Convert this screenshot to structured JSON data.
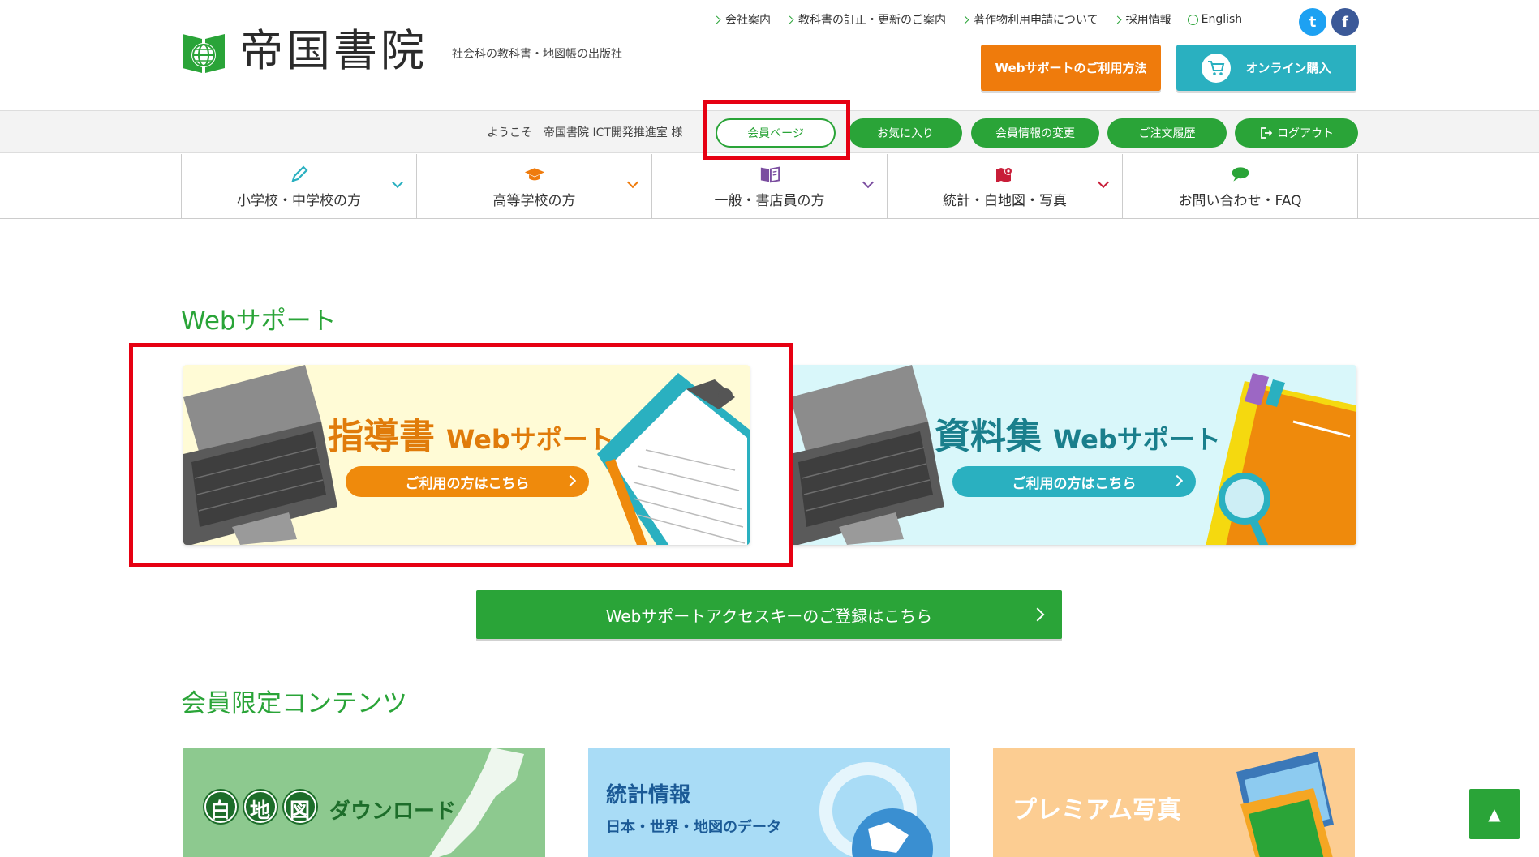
{
  "header": {
    "logo_text": "帝国書院",
    "tagline": "社会科の教科書・地図帳の出版社",
    "top_links": [
      "会社案内",
      "教科書の訂正・更新のご案内",
      "著作物利用申請について",
      "採用情報"
    ],
    "english_label": "English",
    "twitter_glyph": "t",
    "facebook_glyph": "f",
    "web_support_usage_label": "Webサポートのご利用方法",
    "online_purchase_label": "オンライン購入"
  },
  "member_bar": {
    "welcome": "ようこそ　帝国書院 ICT開発推進室 様",
    "member_page": "会員ページ",
    "favorites": "お気に入り",
    "change_info": "会員情報の変更",
    "order_history": "ご注文履歴",
    "logout": "ログアウト"
  },
  "nav": {
    "items": [
      {
        "label": "小学校・中学校の方",
        "icon": "pencil-icon",
        "color": "#2ab0c0"
      },
      {
        "label": "高等学校の方",
        "icon": "graduation-cap-icon",
        "color": "#ef7b0c"
      },
      {
        "label": "一般・書店員の方",
        "icon": "book-icon",
        "color": "#7b4ea0"
      },
      {
        "label": "統計・白地図・写真",
        "icon": "map-pin-icon",
        "color": "#c81d38"
      },
      {
        "label": "お問い合わせ・FAQ",
        "icon": "chat-icon",
        "color": "#2aa438"
      }
    ]
  },
  "web_support": {
    "title": "Webサポート",
    "guide_banner": {
      "title": "指導書",
      "sub": "Webサポート",
      "button": "ご利用の方はこちら"
    },
    "materials_banner": {
      "title": "資料集",
      "sub": "Webサポート",
      "button": "ご利用の方はこちら"
    },
    "access_key_button": "Webサポートアクセスキーのご登録はこちら"
  },
  "member_content": {
    "title": "会員限定コンテンツ",
    "cards": [
      {
        "chars": [
          "白",
          "地",
          "図"
        ],
        "label": "ダウンロード"
      },
      {
        "title": "統計情報",
        "sub": "日本・世界・地図のデータ"
      },
      {
        "title": "プレミアム写真"
      }
    ]
  },
  "to_top": "▲",
  "colors": {
    "brand_green": "#2aa438",
    "orange": "#ef7b0c",
    "teal": "#2ab0c0",
    "highlight_red": "#e60012"
  }
}
